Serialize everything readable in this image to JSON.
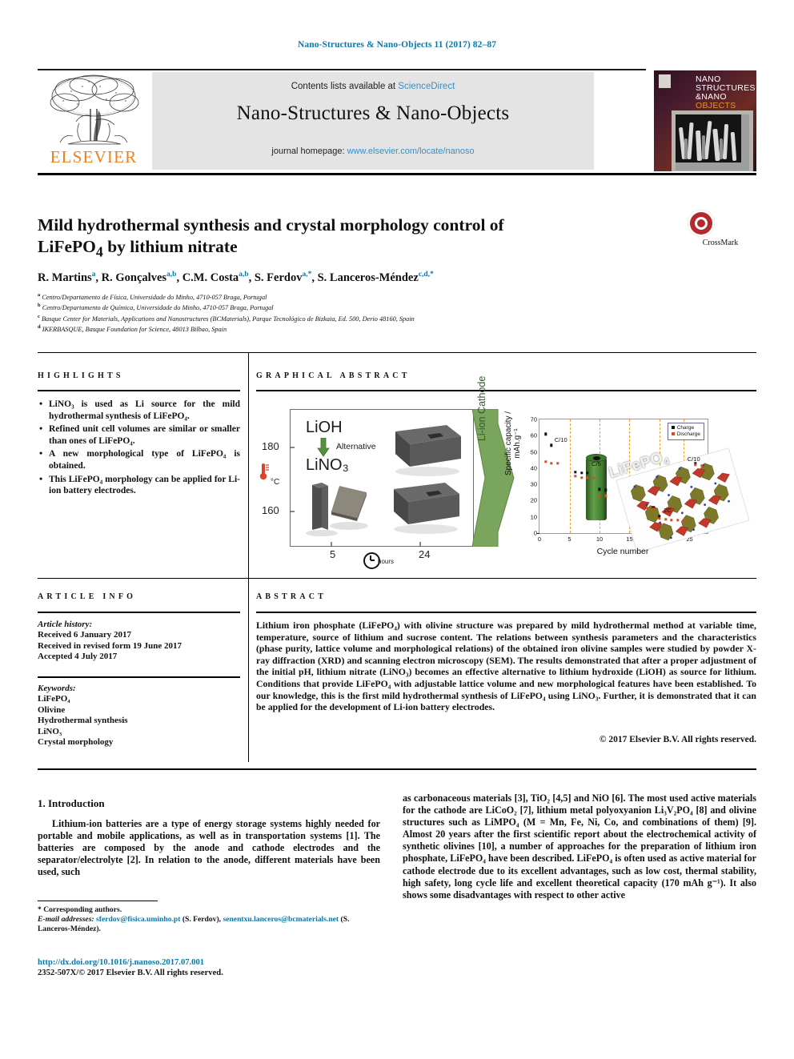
{
  "running_head": "Nano-Structures & Nano-Objects 11 (2017) 82–87",
  "masthead": {
    "contents_lead": "Contents lists available at ",
    "sciencedirect": "ScienceDirect",
    "journal_title": "Nano-Structures & Nano-Objects",
    "homepage_lead": "journal homepage: ",
    "homepage_url": "www.elsevier.com/locate/nanoso",
    "publisher": "ELSEVIER",
    "cover": {
      "line1": "NANO",
      "line2": "STRUCTURES",
      "line3": "&NANO",
      "line4": "OBJECTS"
    }
  },
  "article": {
    "title_line1": "Mild hydrothermal synthesis and crystal morphology control of",
    "title_line2_pre": "LiFePO",
    "title_line2_sub": "4",
    "title_line2_post": " by lithium nitrate",
    "authors": [
      {
        "name": "R. Martins",
        "sup": "a"
      },
      {
        "name": "R. Gonçalves",
        "sup": "a,b"
      },
      {
        "name": "C.M. Costa",
        "sup": "a,b"
      },
      {
        "name": "S. Ferdov",
        "sup": "a,*"
      },
      {
        "name": "S. Lanceros-Méndez",
        "sup": "c,d,*"
      }
    ],
    "affiliations": [
      {
        "mark": "a",
        "text": "Centro/Departamento de Física, Universidade do Minho, 4710-057 Braga, Portugal"
      },
      {
        "mark": "b",
        "text": "Centro/Departamento de Química, Universidade do Minho, 4710-057 Braga, Portugal"
      },
      {
        "mark": "c",
        "text": "Basque Center for Materials, Applications and Nanostructures (BCMaterials), Parque Tecnológico de Bizkaia, Ed. 500, Derio 48160, Spain"
      },
      {
        "mark": "d",
        "text": "IKERBASQUE, Basque Foundation for Science, 48013 Bilbao, Spain"
      }
    ],
    "crossmark_label": "CrossMark"
  },
  "highlights": {
    "heading": "HIGHLIGHTS",
    "items": [
      "LiNO₃ is used as Li source for the mild hydrothermal synthesis of LiFePO₄.",
      "Refined unit cell volumes are similar or smaller than ones of LiFePO₄.",
      "A new morphological type of LiFePO₄ is obtained.",
      "This LiFePO₄ morphology can be applied for Li-ion battery electrodes."
    ]
  },
  "graphical_abstract": {
    "heading": "GRAPHICAL ABSTRACT",
    "left_panel": {
      "reagent_top": "LiOH",
      "reagent_bottom": "LiNO₃",
      "arrow_label": "Alternative",
      "y_ticks": [
        "180",
        "160"
      ],
      "y_unit": "°C",
      "x_ticks": [
        "5",
        "24"
      ],
      "x_unit": "hours",
      "cathode_label": "Li-ion Cathode"
    }
  },
  "chart_data": {
    "type": "scatter",
    "title": "",
    "xlabel": "Cycle number",
    "ylabel": "Specific capacity / mAh.g⁻¹",
    "xlim": [
      0,
      28
    ],
    "ylim": [
      0,
      70
    ],
    "xticks": [
      0,
      5,
      10,
      15,
      20,
      25
    ],
    "yticks": [
      0,
      10,
      20,
      30,
      40,
      50,
      60,
      70
    ],
    "grid": false,
    "legend_position": "top-right",
    "legend": [
      "Charge",
      "Discharge"
    ],
    "annotations": [
      "C/10",
      "C/5",
      "2C",
      "C/10"
    ],
    "rate_dividers_x": [
      5,
      10,
      15,
      20,
      24
    ],
    "watermark": "LiFePO₄",
    "series": [
      {
        "name": "Charge",
        "color": "#111111",
        "x": [
          1,
          2,
          6,
          7,
          8,
          10,
          11,
          19,
          20,
          26
        ],
        "y": [
          61,
          54,
          37.5,
          37,
          37,
          27,
          26.5,
          16,
          10.5,
          43
        ]
      },
      {
        "name": "Discharge",
        "color": "#e04a18",
        "x": [
          1,
          2,
          3,
          6,
          7,
          8,
          9,
          10,
          11,
          18,
          19,
          20,
          21,
          22,
          23,
          24,
          26,
          27
        ],
        "y": [
          44,
          43,
          43,
          35,
          34,
          34,
          34,
          23,
          23,
          15.5,
          15,
          9,
          8.5,
          8,
          8,
          7.5,
          42,
          41.5
        ]
      }
    ]
  },
  "article_info": {
    "heading": "ARTICLE INFO",
    "history_label": "Article history:",
    "history": [
      "Received 6 January 2017",
      "Received in revised form 19 June 2017",
      "Accepted 4 July 2017"
    ],
    "keywords_label": "Keywords:",
    "keywords": [
      "LiFePO₄",
      "Olivine",
      "Hydrothermal synthesis",
      "LiNO₃",
      "Crystal morphology"
    ]
  },
  "abstract": {
    "heading": "ABSTRACT",
    "text": "Lithium iron phosphate (LiFePO₄) with olivine structure was prepared by mild hydrothermal method at variable time, temperature, source of lithium and sucrose content. The relations between synthesis parameters and the characteristics (phase purity, lattice volume and morphological relations) of the obtained iron olivine samples were studied by powder X-ray diffraction (XRD) and scanning electron microscopy (SEM). The results demonstrated that after a proper adjustment of the initial pH, lithium nitrate (LiNO₃) becomes an effective alternative to lithium hydroxide (LiOH) as source for lithium. Conditions that provide LiFePO₄ with adjustable lattice volume and new morphological features have been established. To our knowledge, this is the first mild hydrothermal synthesis of LiFePO₄ using LiNO₃. Further, it is demonstrated that it can be applied for the development of Li-ion battery electrodes.",
    "copyright": "© 2017 Elsevier B.V. All rights reserved."
  },
  "introduction": {
    "section_number_title": "1. Introduction",
    "left_paragraph": "Lithium-ion batteries are a type of energy storage systems highly needed for portable and mobile applications, as well as in transportation systems [1]. The batteries are composed by the anode and cathode electrodes and the separator/electrolyte [2]. In relation to the anode, different materials have been used, such",
    "right_paragraph": "as carbonaceous materials [3], TiO₂ [4,5] and NiO [6]. The most used active materials for the cathode are LiCoO₂ [7], lithium metal polyoxyanion Li₃V₂PO₄ [8] and olivine structures such as LiMPO₄ (M = Mn, Fe, Ni, Co, and combinations of them) [9]. Almost 20 years after the first scientific report about the electrochemical activity of synthetic olivines [10], a number of approaches for the preparation of lithium iron phosphate, LiFePO₄ have been described. LiFePO₄ is often used as active material for cathode electrode due to its excellent advantages, such as low cost, thermal stability, high safety, long cycle life and excellent theoretical capacity (170 mAh g⁻¹). It also shows some disadvantages with respect to other active"
  },
  "footer": {
    "corresponding": "* Corresponding authors.",
    "email_label": "E-mail addresses:",
    "email1": "sferdov@fisica.uminho.pt",
    "email1_owner": "(S. Ferdov),",
    "email2": "senentxu.lanceros@bcmaterials.net",
    "email2_owner": "(S. Lanceros-Méndez).",
    "doi": "http://dx.doi.org/10.1016/j.nanoso.2017.07.001",
    "issn_line": "2352-507X/© 2017 Elsevier B.V. All rights reserved."
  },
  "colors": {
    "link": "#0b77a8",
    "sciencedirect": "#3a8fc4",
    "elsevier_orange": "#f07f1a",
    "crossmark_red": "#b4292e",
    "green_arrow": "#6d9d4e",
    "chart_charge": "#111111",
    "chart_discharge": "#e04a18",
    "rate_divider": "#f0a32a"
  }
}
